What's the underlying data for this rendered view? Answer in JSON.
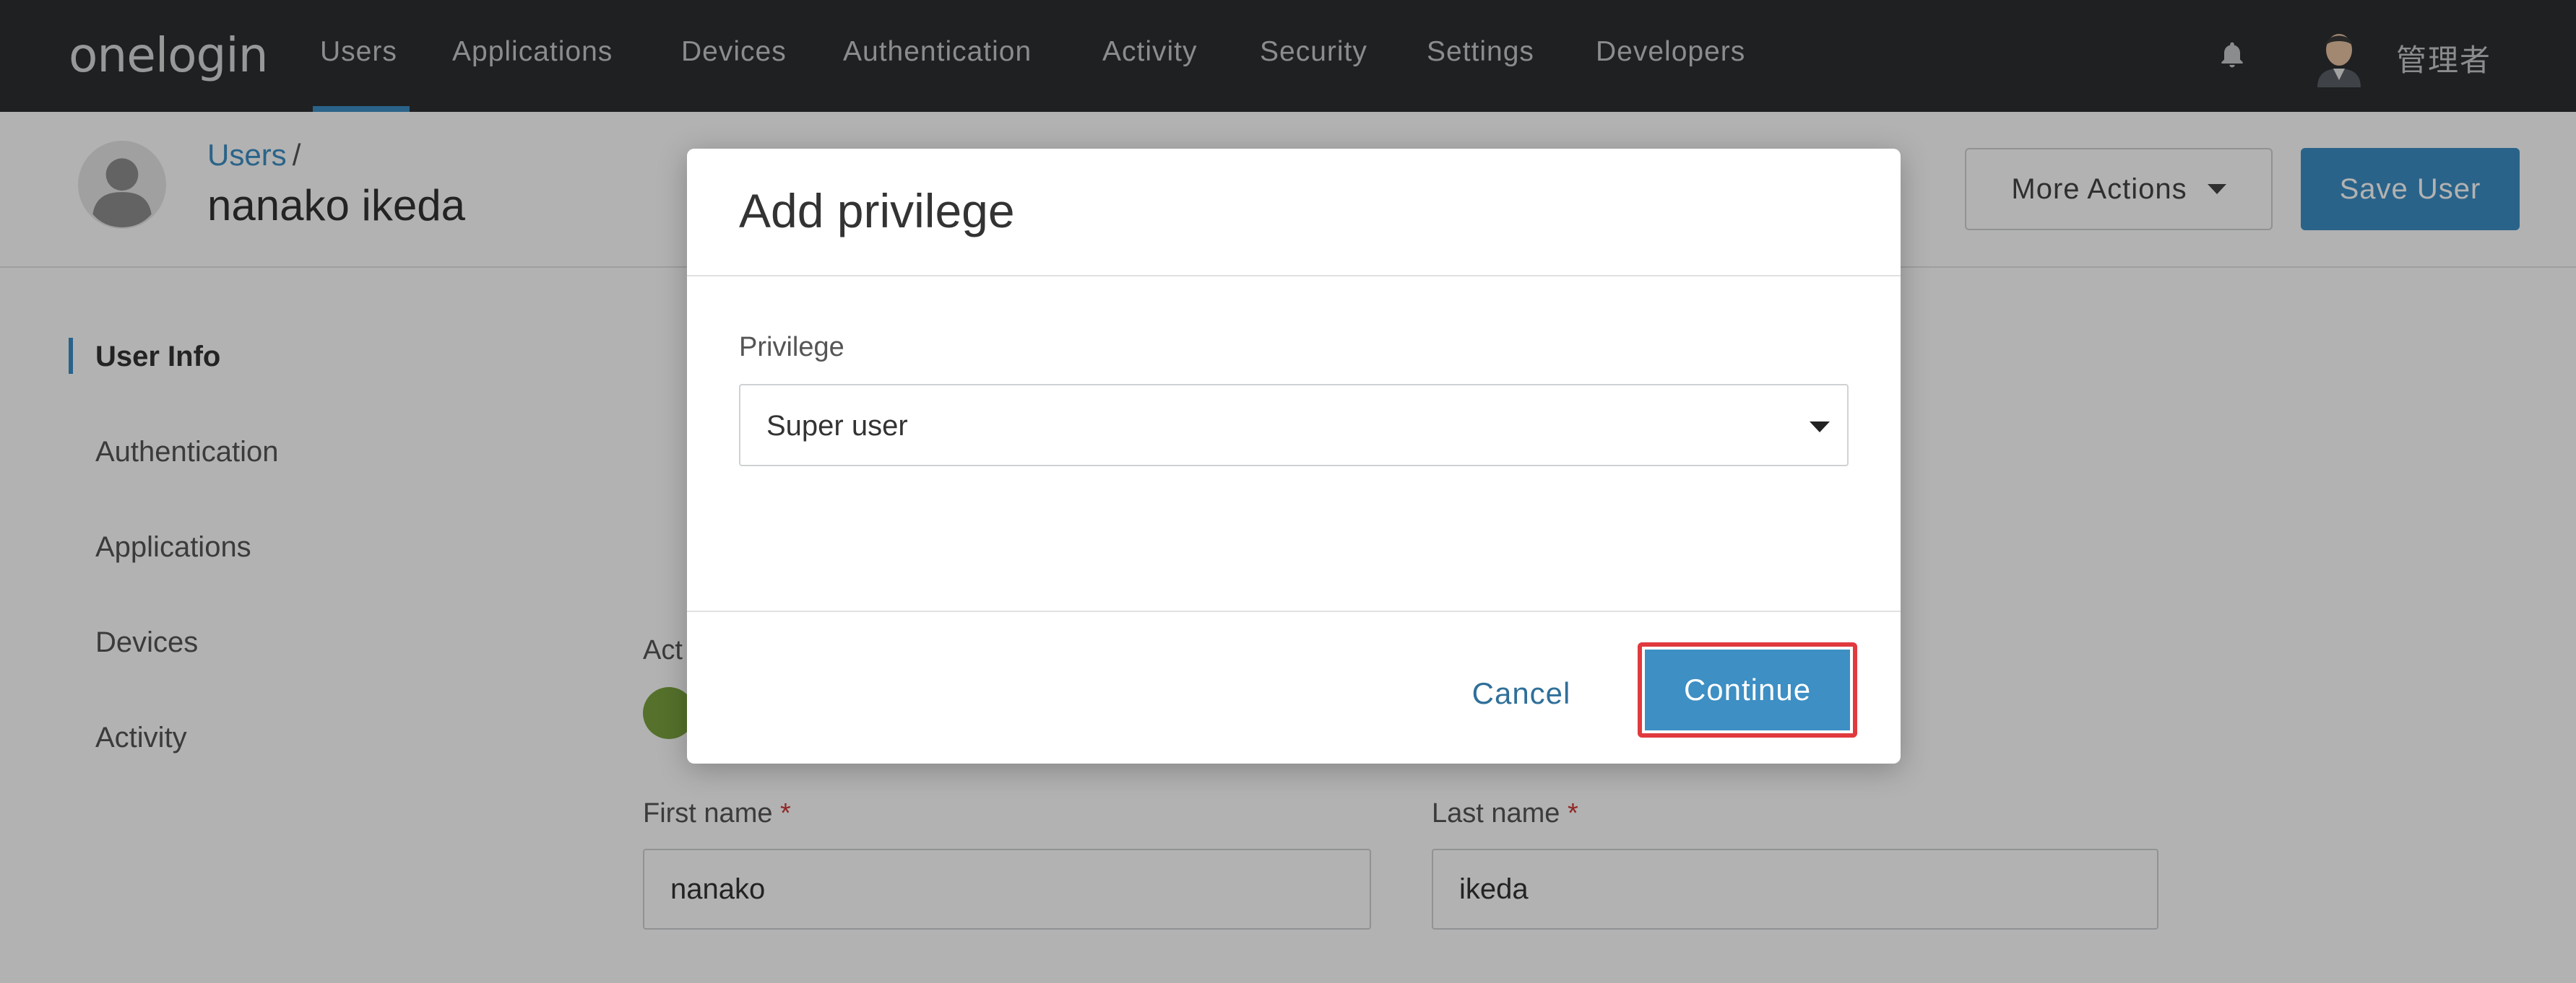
{
  "topnav": {
    "logo": "onelogin",
    "items": [
      {
        "label": "Users",
        "active": true
      },
      {
        "label": "Applications"
      },
      {
        "label": "Devices"
      },
      {
        "label": "Authentication"
      },
      {
        "label": "Activity"
      },
      {
        "label": "Security"
      },
      {
        "label": "Settings"
      },
      {
        "label": "Developers"
      }
    ],
    "admin_name": "管理者"
  },
  "header": {
    "breadcrumb": "Users",
    "breadcrumb_sep": "/",
    "title": "nanako ikeda",
    "more_actions_label": "More Actions",
    "save_label": "Save User"
  },
  "sidebar": {
    "items": [
      {
        "label": "User Info",
        "active": true
      },
      {
        "label": "Authentication"
      },
      {
        "label": "Applications"
      },
      {
        "label": "Devices"
      },
      {
        "label": "Activity"
      }
    ]
  },
  "form": {
    "active_label": "Act",
    "first_name_label": "First name",
    "last_name_label": "Last name",
    "required_mark": "*",
    "first_name_value": "nanako",
    "last_name_value": "ikeda"
  },
  "modal": {
    "title": "Add privilege",
    "privilege_label": "Privilege",
    "privilege_value": "Super user",
    "cancel_label": "Cancel",
    "continue_label": "Continue"
  },
  "colors": {
    "nav_bg": "#2b2e30",
    "accent": "#3d8fc4",
    "highlight": "#e03a3e",
    "active_green": "#7aa33e"
  }
}
